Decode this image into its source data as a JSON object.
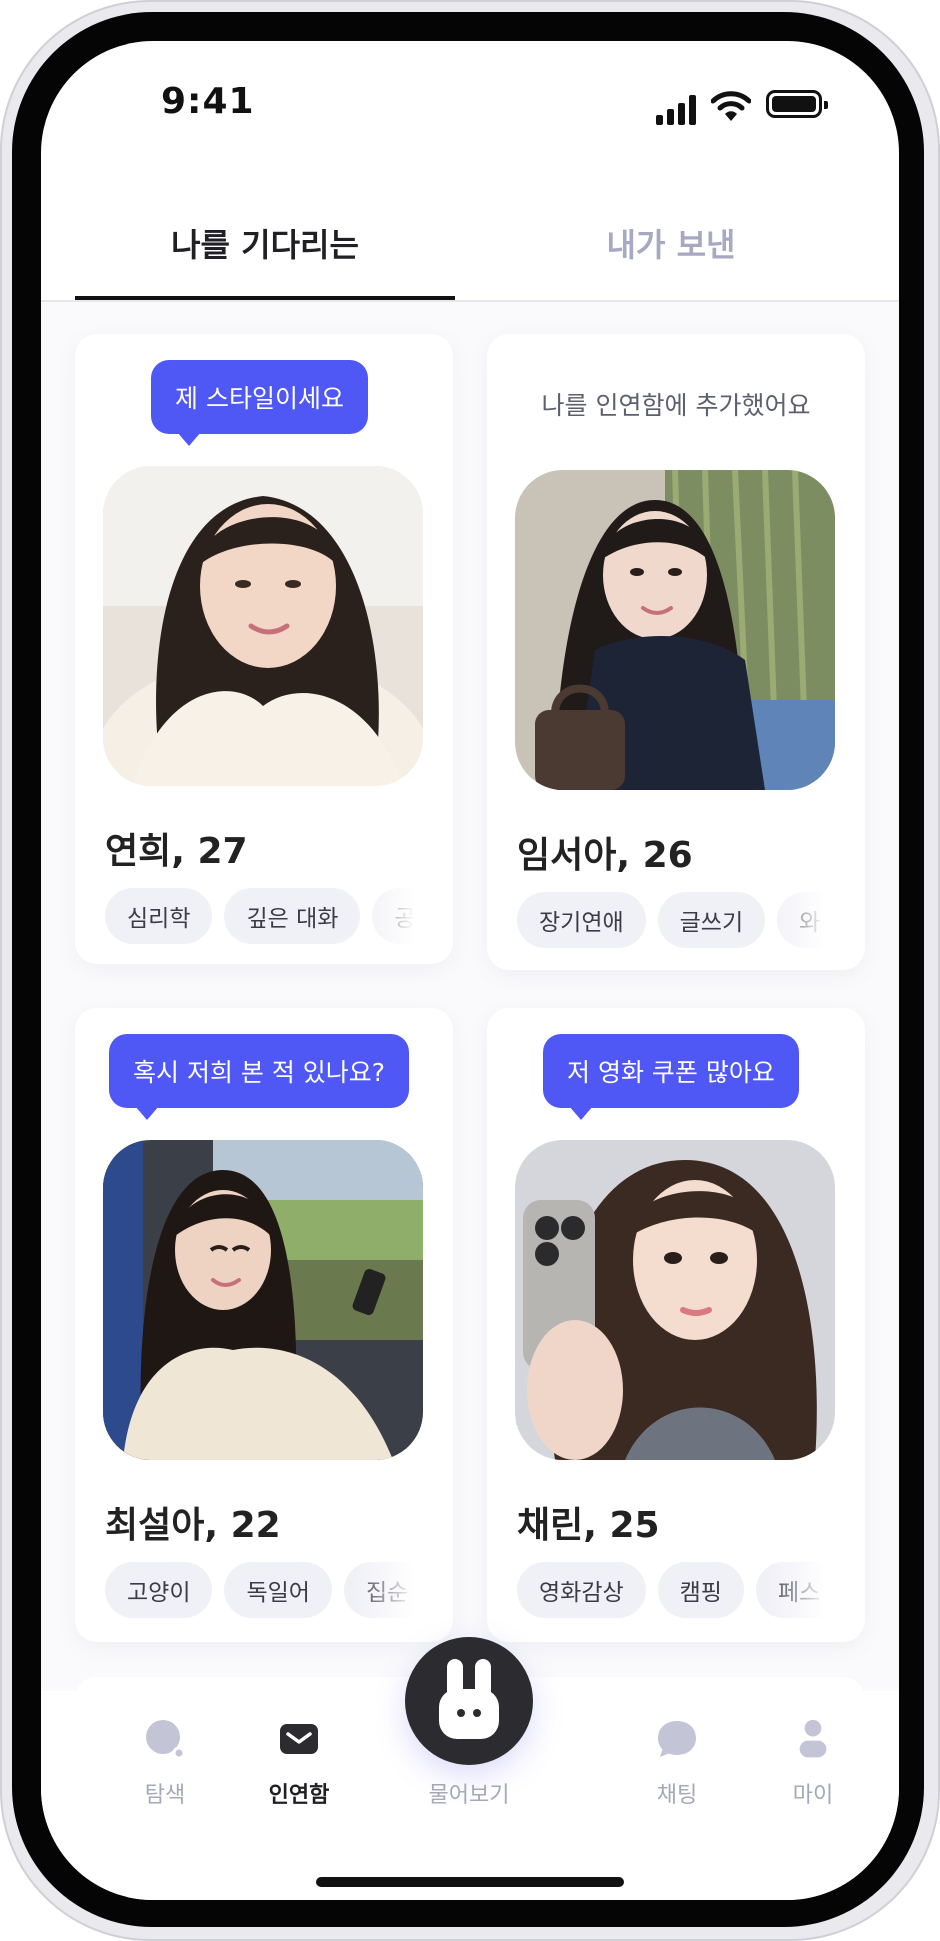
{
  "status_bar": {
    "time": "9:41"
  },
  "tabs": [
    {
      "label": "나를 기다리는",
      "active": true
    },
    {
      "label": "내가 보낸",
      "active": false
    }
  ],
  "cards": [
    {
      "message": "제 스타일이세요",
      "message_type": "bubble",
      "name": "연희, 27",
      "tags": [
        "심리학",
        "깊은 대화",
        "공"
      ]
    },
    {
      "message": "나를 인연함에 추가했어요",
      "message_type": "note",
      "name": "임서아, 26",
      "tags": [
        "장기연애",
        "글쓰기",
        "와"
      ]
    },
    {
      "message": "혹시 저희 본 적 있나요?",
      "message_type": "bubble",
      "name": "최설아, 22",
      "tags": [
        "고양이",
        "독일어",
        "집순"
      ]
    },
    {
      "message": "저 영화 쿠폰 많아요",
      "message_type": "bubble",
      "name": "채린, 25",
      "tags": [
        "영화감상",
        "캠핑",
        "페스"
      ]
    }
  ],
  "bottom_nav": {
    "items": [
      {
        "label": "탐색",
        "icon": "search-icon",
        "active": false
      },
      {
        "label": "인연함",
        "icon": "mail-icon",
        "active": true
      },
      {
        "label": "물어보기",
        "icon": "bunny-icon",
        "active": false
      },
      {
        "label": "채팅",
        "icon": "chat-bubble-icon",
        "active": false
      },
      {
        "label": "마이",
        "icon": "person-icon",
        "active": false
      }
    ]
  },
  "colors": {
    "accent": "#4f58f5",
    "text_primary": "#1f1f24",
    "text_muted": "#a6a7ba",
    "chip_bg": "#f0f0f7",
    "center_button": "#2b2b30"
  }
}
